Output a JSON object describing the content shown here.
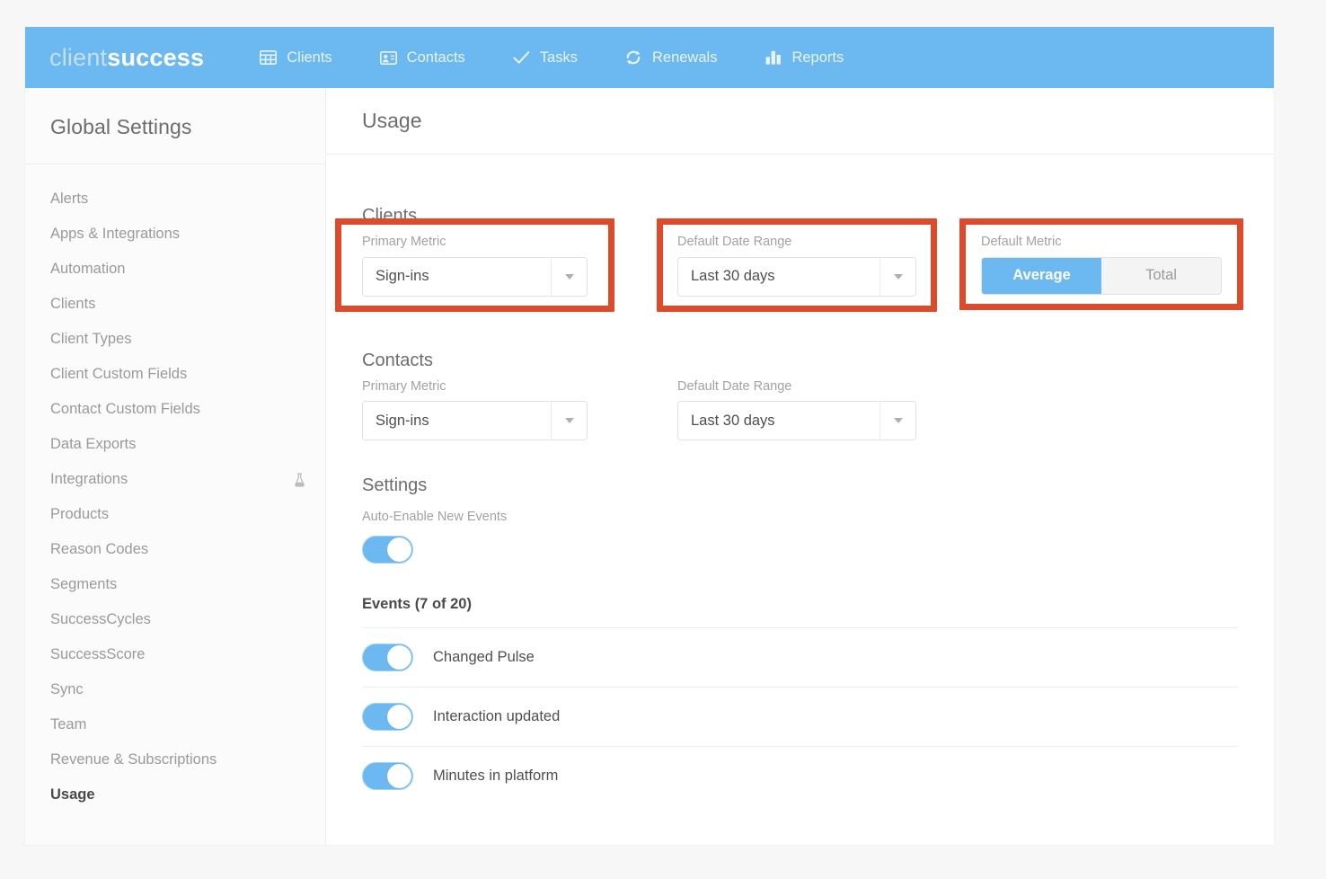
{
  "brand": {
    "light": "client",
    "bold": "success"
  },
  "topnav": {
    "items": [
      {
        "label": "Clients",
        "icon": "grid-icon"
      },
      {
        "label": "Contacts",
        "icon": "contact-card-icon"
      },
      {
        "label": "Tasks",
        "icon": "check-icon"
      },
      {
        "label": "Renewals",
        "icon": "refresh-icon"
      },
      {
        "label": "Reports",
        "icon": "bar-chart-icon"
      }
    ]
  },
  "sidebar": {
    "title": "Global Settings",
    "items": [
      {
        "label": "Alerts",
        "active": false,
        "badge": ""
      },
      {
        "label": "Apps & Integrations",
        "active": false,
        "badge": ""
      },
      {
        "label": "Automation",
        "active": false,
        "badge": ""
      },
      {
        "label": "Clients",
        "active": false,
        "badge": ""
      },
      {
        "label": "Client Types",
        "active": false,
        "badge": ""
      },
      {
        "label": "Client Custom Fields",
        "active": false,
        "badge": ""
      },
      {
        "label": "Contact Custom Fields",
        "active": false,
        "badge": ""
      },
      {
        "label": "Data Exports",
        "active": false,
        "badge": ""
      },
      {
        "label": "Integrations",
        "active": false,
        "badge": "beaker-icon"
      },
      {
        "label": "Products",
        "active": false,
        "badge": ""
      },
      {
        "label": "Reason Codes",
        "active": false,
        "badge": ""
      },
      {
        "label": "Segments",
        "active": false,
        "badge": ""
      },
      {
        "label": "SuccessCycles",
        "active": false,
        "badge": ""
      },
      {
        "label": "SuccessScore",
        "active": false,
        "badge": ""
      },
      {
        "label": "Sync",
        "active": false,
        "badge": ""
      },
      {
        "label": "Team",
        "active": false,
        "badge": ""
      },
      {
        "label": "Revenue & Subscriptions",
        "active": false,
        "badge": ""
      },
      {
        "label": "Usage",
        "active": true,
        "badge": ""
      }
    ]
  },
  "main": {
    "page_title": "Usage",
    "clients": {
      "heading": "Clients",
      "primary_metric": {
        "label": "Primary Metric",
        "value": "Sign-ins"
      },
      "default_date_range": {
        "label": "Default Date Range",
        "value": "Last 30 days"
      },
      "default_metric": {
        "label": "Default Metric",
        "options": [
          "Average",
          "Total"
        ],
        "selected": "Average"
      }
    },
    "contacts": {
      "heading": "Contacts",
      "primary_metric": {
        "label": "Primary Metric",
        "value": "Sign-ins"
      },
      "default_date_range": {
        "label": "Default Date Range",
        "value": "Last 30 days"
      }
    },
    "settings": {
      "heading": "Settings",
      "auto_enable_label": "Auto-Enable New Events",
      "auto_enable_on": true,
      "events_heading": "Events (7 of 20)",
      "events": [
        {
          "label": "Changed Pulse",
          "enabled": true
        },
        {
          "label": "Interaction updated",
          "enabled": true
        },
        {
          "label": "Minutes in platform",
          "enabled": true
        }
      ]
    }
  },
  "colors": {
    "brand_blue": "#6cb8f0",
    "highlight_red": "#dd4b2d",
    "page_background": "#f7f7f7",
    "text_muted": "#9a9a9a"
  }
}
